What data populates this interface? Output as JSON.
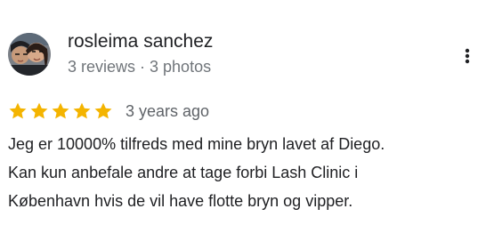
{
  "review": {
    "reviewer_name": "rosleima sanchez",
    "reviewer_meta": "3 reviews · 3 photos",
    "rating": 5,
    "rating_max": 5,
    "time_ago": "3 years ago",
    "text": "Jeg er 10000% tilfreds med mine bryn lavet af Diego.\nKan kun anbefale andre at tage forbi Lash Clinic i\nKøbenhavn hvis de vil have flotte bryn og vipper.",
    "more_icon": "more-vert-icon",
    "star_icon": "star-icon"
  },
  "colors": {
    "star": "#f4b400",
    "name": "#202124",
    "meta": "#70757a",
    "text": "#202124"
  }
}
